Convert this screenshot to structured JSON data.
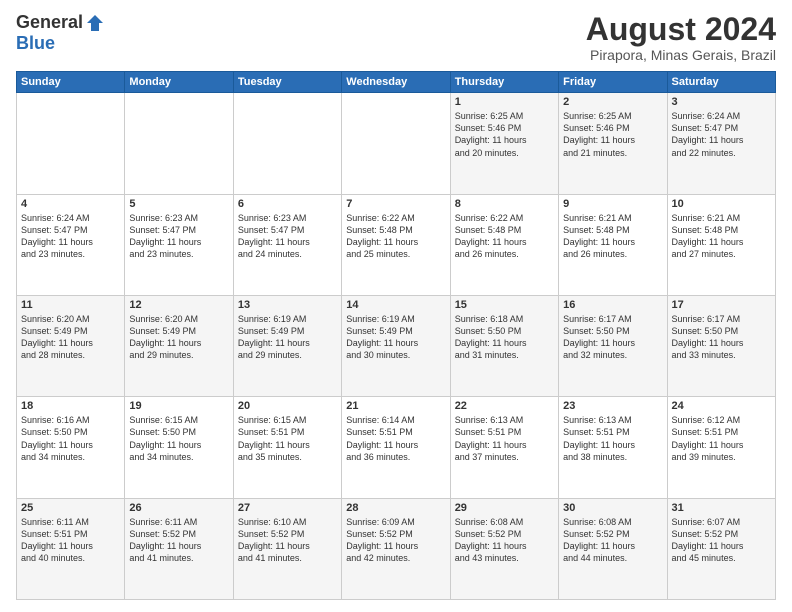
{
  "header": {
    "logo_general": "General",
    "logo_blue": "Blue",
    "month_year": "August 2024",
    "location": "Pirapora, Minas Gerais, Brazil"
  },
  "weekdays": [
    "Sunday",
    "Monday",
    "Tuesday",
    "Wednesday",
    "Thursday",
    "Friday",
    "Saturday"
  ],
  "weeks": [
    [
      {
        "day": "",
        "info": ""
      },
      {
        "day": "",
        "info": ""
      },
      {
        "day": "",
        "info": ""
      },
      {
        "day": "",
        "info": ""
      },
      {
        "day": "1",
        "info": "Sunrise: 6:25 AM\nSunset: 5:46 PM\nDaylight: 11 hours\nand 20 minutes."
      },
      {
        "day": "2",
        "info": "Sunrise: 6:25 AM\nSunset: 5:46 PM\nDaylight: 11 hours\nand 21 minutes."
      },
      {
        "day": "3",
        "info": "Sunrise: 6:24 AM\nSunset: 5:47 PM\nDaylight: 11 hours\nand 22 minutes."
      }
    ],
    [
      {
        "day": "4",
        "info": "Sunrise: 6:24 AM\nSunset: 5:47 PM\nDaylight: 11 hours\nand 23 minutes."
      },
      {
        "day": "5",
        "info": "Sunrise: 6:23 AM\nSunset: 5:47 PM\nDaylight: 11 hours\nand 23 minutes."
      },
      {
        "day": "6",
        "info": "Sunrise: 6:23 AM\nSunset: 5:47 PM\nDaylight: 11 hours\nand 24 minutes."
      },
      {
        "day": "7",
        "info": "Sunrise: 6:22 AM\nSunset: 5:48 PM\nDaylight: 11 hours\nand 25 minutes."
      },
      {
        "day": "8",
        "info": "Sunrise: 6:22 AM\nSunset: 5:48 PM\nDaylight: 11 hours\nand 26 minutes."
      },
      {
        "day": "9",
        "info": "Sunrise: 6:21 AM\nSunset: 5:48 PM\nDaylight: 11 hours\nand 26 minutes."
      },
      {
        "day": "10",
        "info": "Sunrise: 6:21 AM\nSunset: 5:48 PM\nDaylight: 11 hours\nand 27 minutes."
      }
    ],
    [
      {
        "day": "11",
        "info": "Sunrise: 6:20 AM\nSunset: 5:49 PM\nDaylight: 11 hours\nand 28 minutes."
      },
      {
        "day": "12",
        "info": "Sunrise: 6:20 AM\nSunset: 5:49 PM\nDaylight: 11 hours\nand 29 minutes."
      },
      {
        "day": "13",
        "info": "Sunrise: 6:19 AM\nSunset: 5:49 PM\nDaylight: 11 hours\nand 29 minutes."
      },
      {
        "day": "14",
        "info": "Sunrise: 6:19 AM\nSunset: 5:49 PM\nDaylight: 11 hours\nand 30 minutes."
      },
      {
        "day": "15",
        "info": "Sunrise: 6:18 AM\nSunset: 5:50 PM\nDaylight: 11 hours\nand 31 minutes."
      },
      {
        "day": "16",
        "info": "Sunrise: 6:17 AM\nSunset: 5:50 PM\nDaylight: 11 hours\nand 32 minutes."
      },
      {
        "day": "17",
        "info": "Sunrise: 6:17 AM\nSunset: 5:50 PM\nDaylight: 11 hours\nand 33 minutes."
      }
    ],
    [
      {
        "day": "18",
        "info": "Sunrise: 6:16 AM\nSunset: 5:50 PM\nDaylight: 11 hours\nand 34 minutes."
      },
      {
        "day": "19",
        "info": "Sunrise: 6:15 AM\nSunset: 5:50 PM\nDaylight: 11 hours\nand 34 minutes."
      },
      {
        "day": "20",
        "info": "Sunrise: 6:15 AM\nSunset: 5:51 PM\nDaylight: 11 hours\nand 35 minutes."
      },
      {
        "day": "21",
        "info": "Sunrise: 6:14 AM\nSunset: 5:51 PM\nDaylight: 11 hours\nand 36 minutes."
      },
      {
        "day": "22",
        "info": "Sunrise: 6:13 AM\nSunset: 5:51 PM\nDaylight: 11 hours\nand 37 minutes."
      },
      {
        "day": "23",
        "info": "Sunrise: 6:13 AM\nSunset: 5:51 PM\nDaylight: 11 hours\nand 38 minutes."
      },
      {
        "day": "24",
        "info": "Sunrise: 6:12 AM\nSunset: 5:51 PM\nDaylight: 11 hours\nand 39 minutes."
      }
    ],
    [
      {
        "day": "25",
        "info": "Sunrise: 6:11 AM\nSunset: 5:51 PM\nDaylight: 11 hours\nand 40 minutes."
      },
      {
        "day": "26",
        "info": "Sunrise: 6:11 AM\nSunset: 5:52 PM\nDaylight: 11 hours\nand 41 minutes."
      },
      {
        "day": "27",
        "info": "Sunrise: 6:10 AM\nSunset: 5:52 PM\nDaylight: 11 hours\nand 41 minutes."
      },
      {
        "day": "28",
        "info": "Sunrise: 6:09 AM\nSunset: 5:52 PM\nDaylight: 11 hours\nand 42 minutes."
      },
      {
        "day": "29",
        "info": "Sunrise: 6:08 AM\nSunset: 5:52 PM\nDaylight: 11 hours\nand 43 minutes."
      },
      {
        "day": "30",
        "info": "Sunrise: 6:08 AM\nSunset: 5:52 PM\nDaylight: 11 hours\nand 44 minutes."
      },
      {
        "day": "31",
        "info": "Sunrise: 6:07 AM\nSunset: 5:52 PM\nDaylight: 11 hours\nand 45 minutes."
      }
    ]
  ]
}
